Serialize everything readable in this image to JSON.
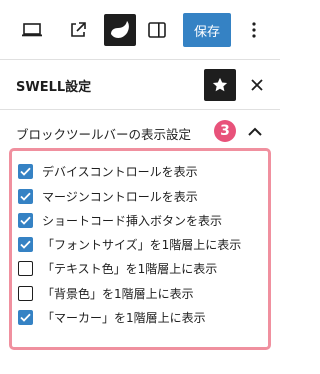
{
  "toolbar": {
    "save_label": "保存",
    "icons": [
      "laptop-icon",
      "external-link-icon",
      "swell-logo-icon",
      "sidebar-toggle-icon",
      "more-vertical-icon"
    ]
  },
  "panel": {
    "title": "SWELL設定",
    "star_icon": "star-icon",
    "close_icon": "close-icon"
  },
  "section": {
    "title": "ブロックツールバーの表示設定",
    "badge": "3",
    "expanded": true,
    "highlight_color": "#f0909f",
    "badge_color": "#e8527a"
  },
  "options": [
    {
      "label": "デバイスコントロールを表示",
      "checked": true
    },
    {
      "label": "マージンコントロールを表示",
      "checked": true
    },
    {
      "label": "ショートコード挿入ボタンを表示",
      "checked": true
    },
    {
      "label": "「フォントサイズ」を1階層上に表示",
      "checked": true
    },
    {
      "label": "「テキスト色」を1階層上に表示",
      "checked": false
    },
    {
      "label": "「背景色」を1階層上に表示",
      "checked": false
    },
    {
      "label": "「マーカー」を1階層上に表示",
      "checked": true
    }
  ],
  "colors": {
    "accent": "#3582c4",
    "dark": "#1e1e1e"
  }
}
